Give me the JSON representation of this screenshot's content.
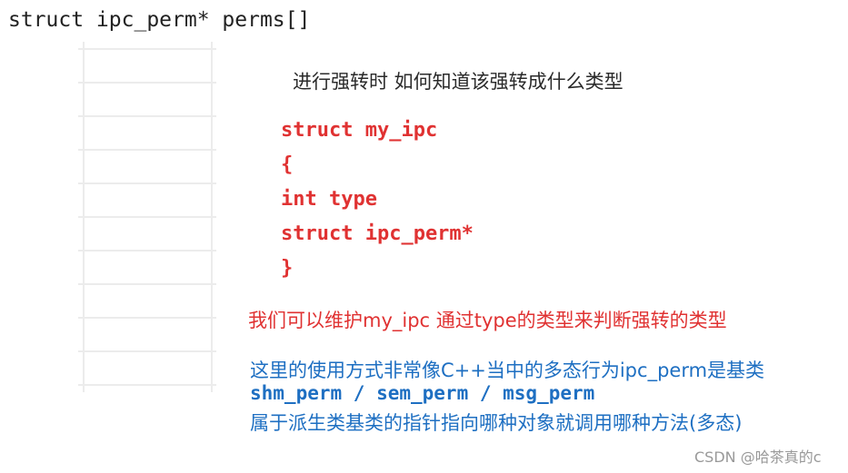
{
  "title": "struct ipc_perm* perms[]",
  "grid": {
    "rows": 10
  },
  "question": "进行强转时  如何知道该强转成什么类型",
  "code_block": [
    "struct my_ipc",
    "{",
    "int type",
    "struct ipc_perm*",
    "}"
  ],
  "red_note": "我们可以维护my_ipc   通过type的类型来判断强转的类型",
  "blue_notes": [
    "这里的使用方式非常像C++当中的多态行为ipc_perm是基类",
    "shm_perm / sem_perm / msg_perm",
    "属于派生类基类的指针指向哪种对象就调用哪种方法(多态)"
  ],
  "watermark": "CSDN @哈茶真的c",
  "colors": {
    "red": "#e03232",
    "blue": "#1e6fc2",
    "grid": "#ececec"
  }
}
